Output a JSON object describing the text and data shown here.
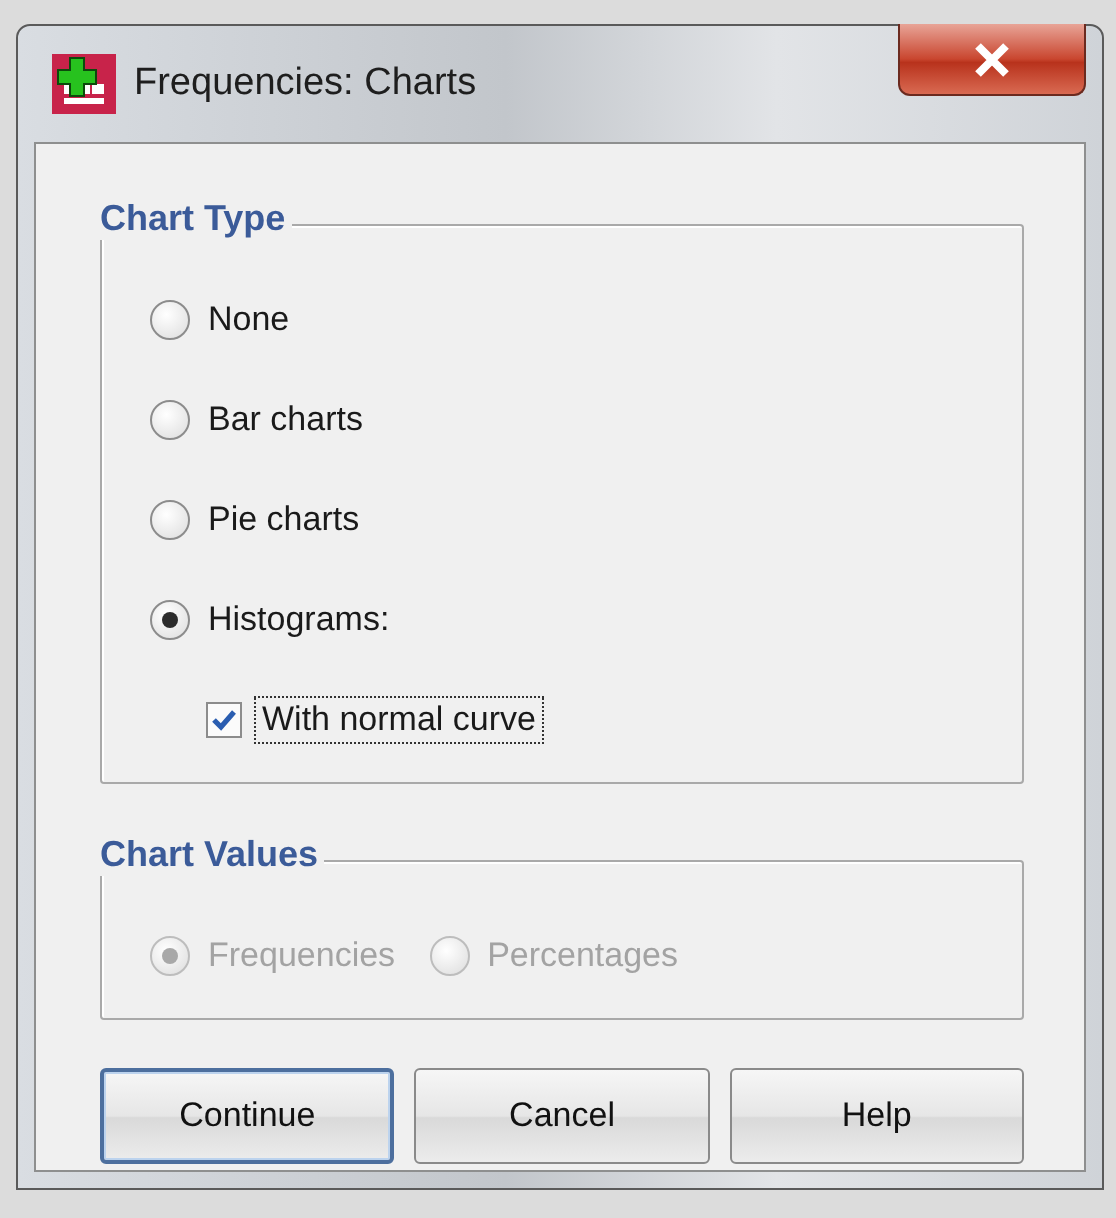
{
  "window": {
    "title": "Frequencies: Charts"
  },
  "groups": [
    {
      "title": "Chart Type",
      "disabled": false,
      "horizontal": false,
      "options": [
        {
          "kind": "radio",
          "label": "None",
          "selected": false
        },
        {
          "kind": "radio",
          "label": "Bar charts",
          "selected": false
        },
        {
          "kind": "radio",
          "label": "Pie charts",
          "selected": false
        },
        {
          "kind": "radio",
          "label": "Histograms:",
          "selected": true,
          "children": [
            {
              "kind": "checkbox",
              "label": "With normal curve",
              "checked": true,
              "focused": true
            }
          ]
        }
      ]
    },
    {
      "title": "Chart Values",
      "disabled": true,
      "horizontal": true,
      "options": [
        {
          "kind": "radio",
          "label": "Frequencies",
          "selected": true
        },
        {
          "kind": "radio",
          "label": "Percentages",
          "selected": false
        }
      ]
    }
  ],
  "buttons": [
    {
      "label": "Continue",
      "default": true
    },
    {
      "label": "Cancel",
      "default": false
    },
    {
      "label": "Help",
      "default": false
    }
  ]
}
